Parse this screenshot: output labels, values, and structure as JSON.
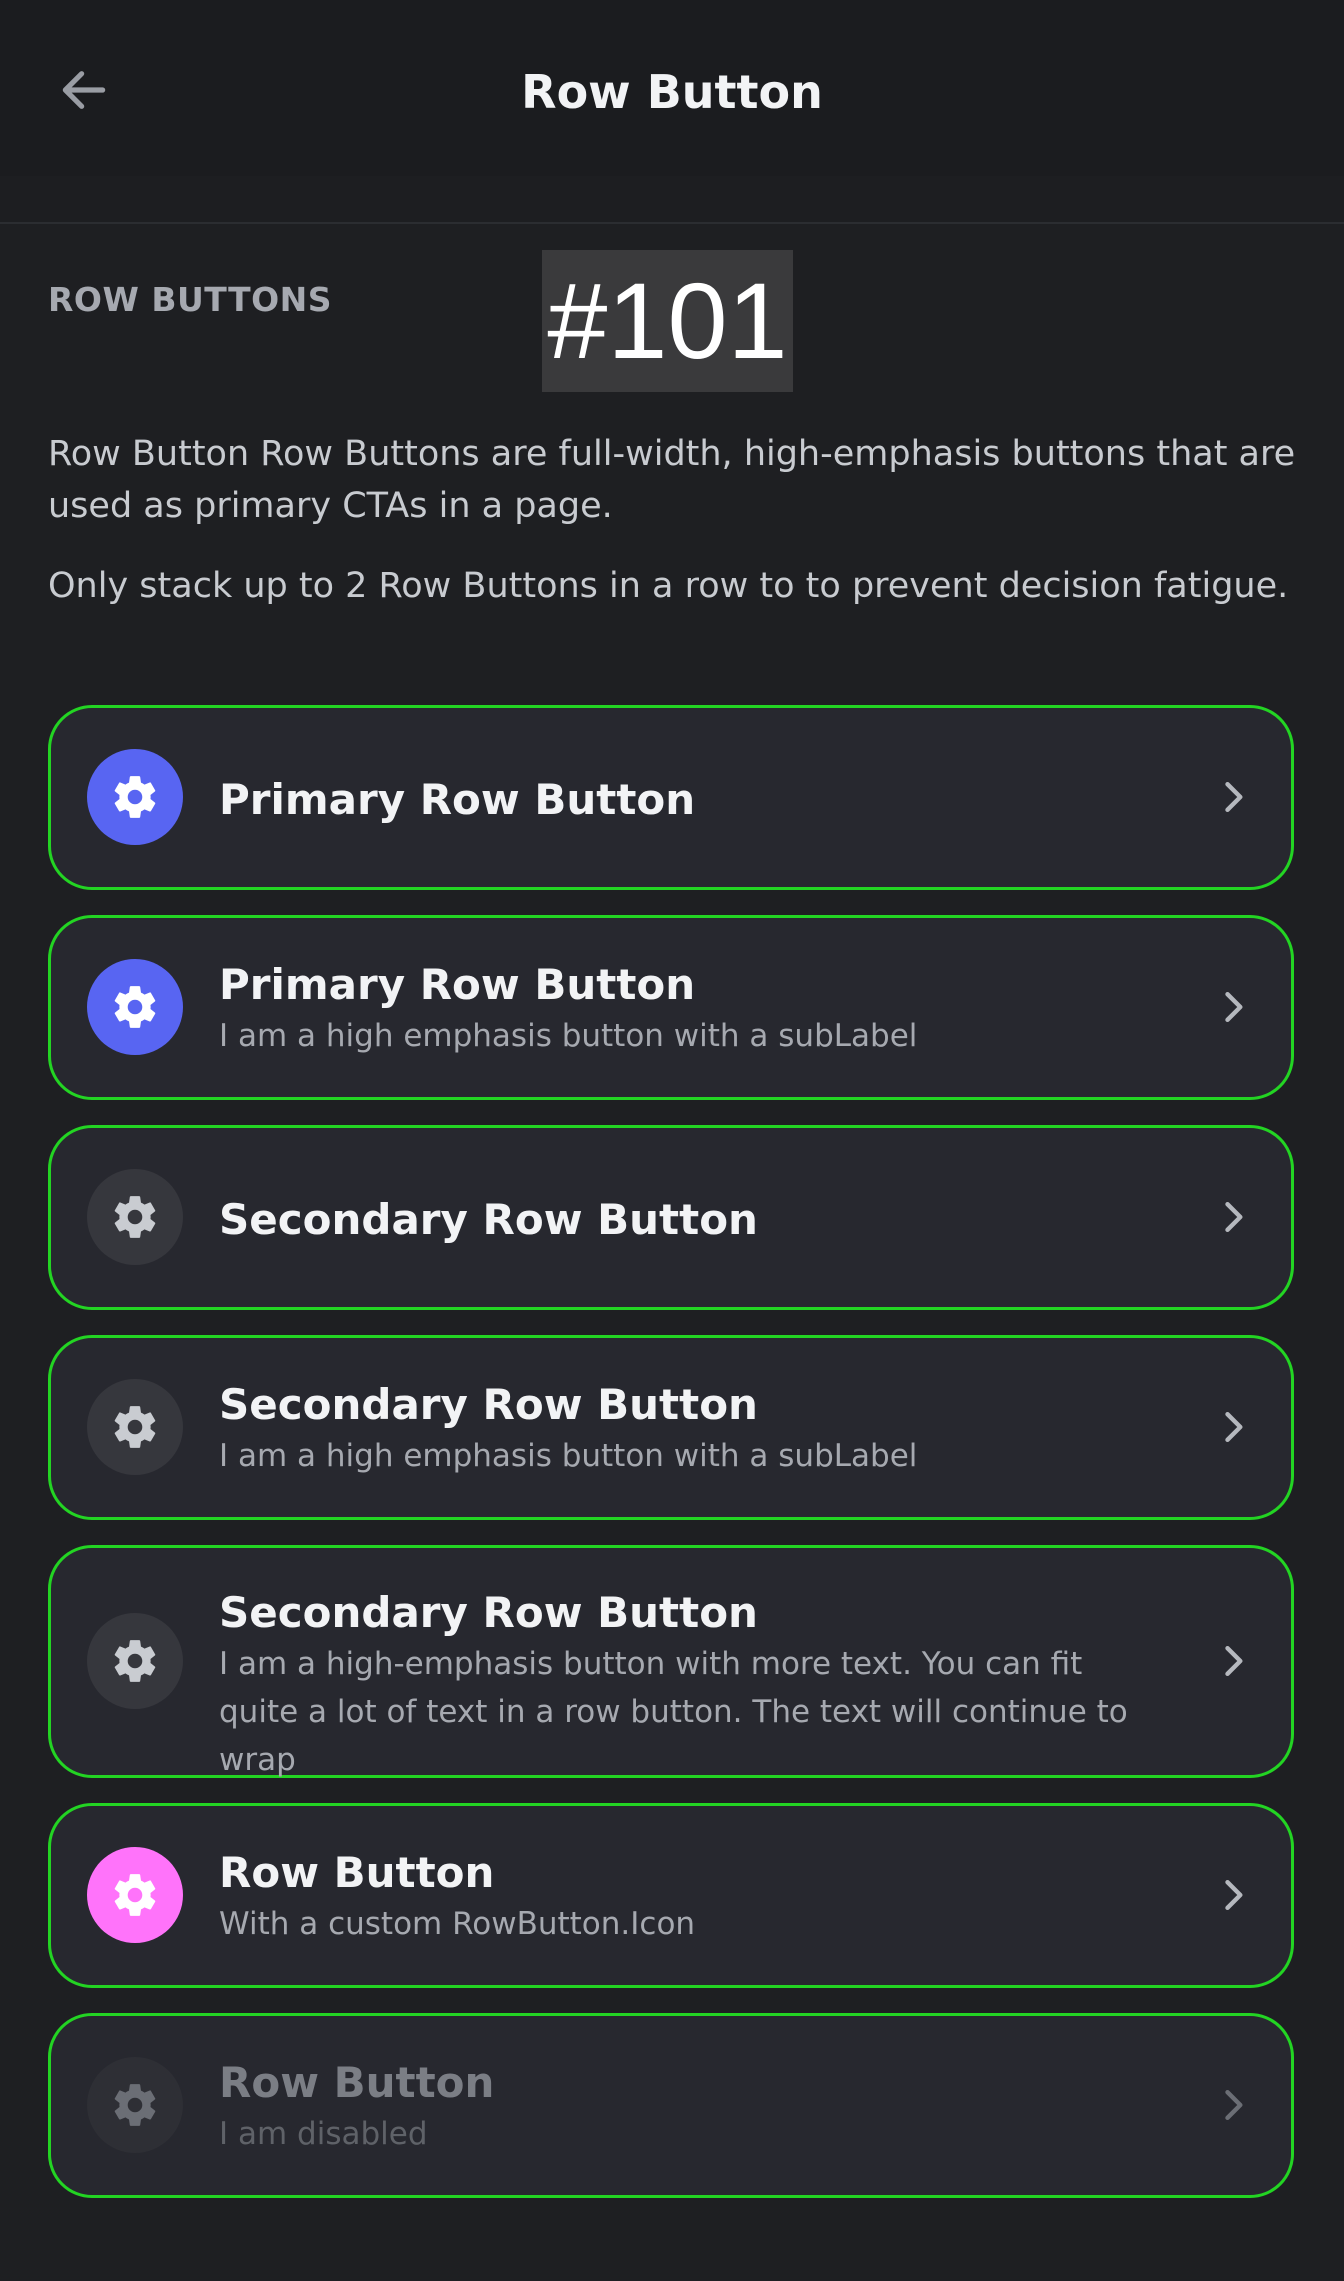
{
  "header": {
    "title": "Row Button",
    "back_icon": "arrow-left-icon"
  },
  "section": {
    "label": "ROW BUTTONS",
    "badge": "#101",
    "description_1": "Row Button Row Buttons are full-width, high-emphasis buttons that are used as primary CTAs in a page.",
    "description_2": "Only stack up to 2 Row Buttons in a row to to prevent decision fatigue."
  },
  "colors": {
    "primary": "#5865f2",
    "secondary": "#36373d",
    "custom": "#ff73fa",
    "disabled": "#2e2f35",
    "outline": "#23d423"
  },
  "buttons": [
    {
      "variant": "primary",
      "icon": "gear-icon",
      "label": "Primary Row Button",
      "sub": ""
    },
    {
      "variant": "primary",
      "icon": "gear-icon",
      "label": "Primary Row Button",
      "sub": "I am a high emphasis button with a subLabel"
    },
    {
      "variant": "secondary",
      "icon": "gear-icon",
      "label": "Secondary Row Button",
      "sub": ""
    },
    {
      "variant": "secondary",
      "icon": "gear-icon",
      "label": "Secondary Row Button",
      "sub": "I am a high emphasis button with a subLabel"
    },
    {
      "variant": "secondary",
      "icon": "gear-icon",
      "label": "Secondary Row Button",
      "sub": "I am a high-emphasis button with more text. You can fit quite a lot of text in a row button. The text will continue to wrap"
    },
    {
      "variant": "custom",
      "icon": "gear-icon",
      "label": "Row Button",
      "sub": "With a custom RowButton.Icon"
    },
    {
      "variant": "disabled",
      "icon": "gear-icon",
      "label": "Row Button",
      "sub": "I am disabled"
    }
  ]
}
